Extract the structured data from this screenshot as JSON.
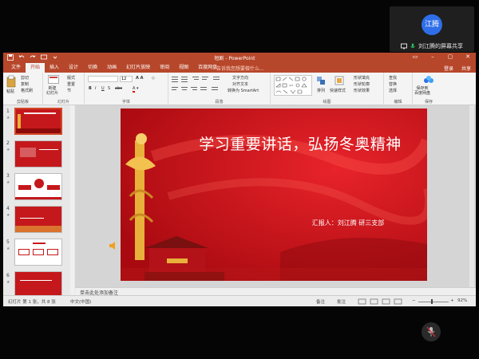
{
  "meeting": {
    "presenter_avatar": "江腾",
    "presenter_label": "刘江腾的屏幕共享"
  },
  "window": {
    "title": "短剧 - PowerPoint",
    "controls": [
      "▭",
      "–",
      "▢",
      "✕"
    ]
  },
  "tabs": [
    {
      "label": "文件"
    },
    {
      "label": "开始"
    },
    {
      "label": "插入"
    },
    {
      "label": "设计"
    },
    {
      "label": "切换"
    },
    {
      "label": "动画"
    },
    {
      "label": "幻灯片放映"
    },
    {
      "label": "审阅"
    },
    {
      "label": "视图"
    },
    {
      "label": "百度网盘"
    }
  ],
  "tell_me": "告诉我您想要做什么...",
  "account": {
    "login": "登录",
    "share": "共享"
  },
  "ribbon": {
    "clipboard": {
      "paste": "粘贴",
      "cut": "剪切",
      "copy": "复制",
      "format_painter": "格式刷",
      "label": "剪贴板"
    },
    "slides": {
      "new_slide": "新建\n幻灯片",
      "layout": "版式",
      "reset": "重置",
      "section": "节",
      "label": "幻灯片"
    },
    "font": {
      "size_value": "12",
      "label": "字体",
      "bold": "B",
      "italic": "I",
      "underline": "U",
      "strike": "S",
      "shadow": "abc"
    },
    "paragraph": {
      "text_direction": "文字方向",
      "align_text": "对齐文本",
      "smartart": "转换为 SmartArt",
      "label": "段落"
    },
    "drawing": {
      "arrange": "排列",
      "quick_styles": "快速样式",
      "fill": "形状填充",
      "outline": "形状轮廓",
      "effect": "形状效果",
      "label": "绘图"
    },
    "editing": {
      "find": "查找",
      "replace": "替换",
      "select": "选择",
      "label": "编辑"
    },
    "baidu": {
      "save": "保存到\n百度网盘",
      "label": "保存"
    }
  },
  "slides_pane": [
    {
      "num": "1",
      "selected": true,
      "style": "red"
    },
    {
      "num": "2",
      "selected": false,
      "style": "red"
    },
    {
      "num": "3",
      "selected": false,
      "style": "white"
    },
    {
      "num": "4",
      "selected": false,
      "style": "red"
    },
    {
      "num": "5",
      "selected": false,
      "style": "white"
    },
    {
      "num": "6",
      "selected": false,
      "style": "red"
    }
  ],
  "slide": {
    "title": "学习重要讲话，弘扬冬奥精神",
    "subtitle": "汇报人：刘江腾    研三支部"
  },
  "notes_placeholder": "单击此处添加备注",
  "status": {
    "slide_info": "幻灯片 第 1 张，共 8 张",
    "language": "中文(中国)",
    "notes": "备注",
    "comments": "批注",
    "zoom": "92%"
  },
  "colors": {
    "brand": "#b7472a",
    "slide_red": "#c41015",
    "slide_gold": "#e8b13a"
  }
}
